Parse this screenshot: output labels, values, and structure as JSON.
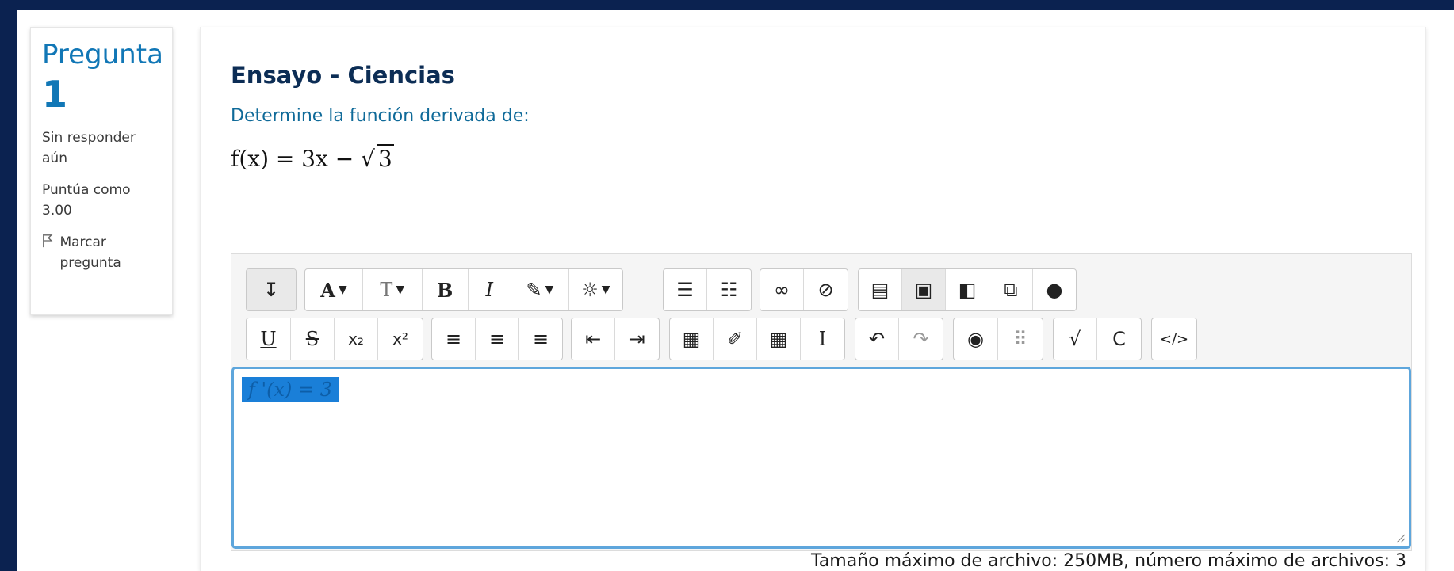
{
  "question_info": {
    "label": "Pregunta",
    "number": "1",
    "state": "Sin responder aún",
    "grade": "Puntúa como 3.00",
    "flag_label": "Marcar pregunta"
  },
  "question": {
    "title": "Ensayo - Ciencias",
    "prompt": "Determine la función derivada de:",
    "formula_prefix": "f(x) = 3x − ",
    "formula_radicand": "3"
  },
  "editor": {
    "row1": [
      {
        "name": "toolbar-toggle-button",
        "glyph": "↧"
      },
      {
        "name": "font-color-button",
        "glyph": "A▾"
      },
      {
        "name": "font-size-button",
        "glyph": "T▾"
      },
      {
        "name": "bold-button",
        "glyph": "B"
      },
      {
        "name": "italic-button",
        "glyph": "I"
      },
      {
        "name": "highlight-button",
        "glyph": "✎▾"
      },
      {
        "name": "styles-button",
        "glyph": "💡▾"
      },
      {
        "name": "bulleted-list-button",
        "glyph": "☰"
      },
      {
        "name": "numbered-list-button",
        "glyph": "☷"
      },
      {
        "name": "link-button",
        "glyph": "🔗"
      },
      {
        "name": "unlink-button",
        "glyph": "⛓"
      },
      {
        "name": "paste-button",
        "glyph": "📋"
      },
      {
        "name": "image-button",
        "glyph": "🖼"
      },
      {
        "name": "media-button",
        "glyph": "🎞"
      },
      {
        "name": "manage-files-button",
        "glyph": "🗂"
      },
      {
        "name": "record-audio-button",
        "glyph": "🎤"
      }
    ],
    "row2": [
      {
        "name": "underline-button",
        "glyph": "U"
      },
      {
        "name": "strikethrough-button",
        "glyph": "S"
      },
      {
        "name": "subscript-button",
        "glyph": "x₂"
      },
      {
        "name": "superscript-button",
        "glyph": "x²"
      },
      {
        "name": "align-left-button",
        "glyph": "≡"
      },
      {
        "name": "align-center-button",
        "glyph": "≡"
      },
      {
        "name": "align-right-button",
        "glyph": "≡"
      },
      {
        "name": "outdent-button",
        "glyph": "⇤"
      },
      {
        "name": "indent-button",
        "glyph": "⇥"
      },
      {
        "name": "equation-button",
        "glyph": "▦"
      },
      {
        "name": "edit-button",
        "glyph": "✐"
      },
      {
        "name": "table-button",
        "glyph": "▦"
      },
      {
        "name": "cursor-button",
        "glyph": "I"
      },
      {
        "name": "undo-button",
        "glyph": "↶"
      },
      {
        "name": "redo-button",
        "glyph": "↷"
      },
      {
        "name": "accessibility-checker-button",
        "glyph": "♿"
      },
      {
        "name": "screen-reader-helper-button",
        "glyph": "⠿"
      },
      {
        "name": "math-editor-button",
        "glyph": "√"
      },
      {
        "name": "chemistry-editor-button",
        "glyph": "C"
      },
      {
        "name": "html-button",
        "glyph": "</>"
      }
    ],
    "answer_text": "f '(x) = 3"
  },
  "footer": {
    "limits": "Tamaño máximo de archivo: 250MB, número máximo de archivos: 3"
  },
  "colors": {
    "background": "#0b2250",
    "title_blue": "#1177b6",
    "prompt_teal": "#0f6a99",
    "focus_border": "#5ea6dc",
    "selection": "#1a7fd8"
  }
}
